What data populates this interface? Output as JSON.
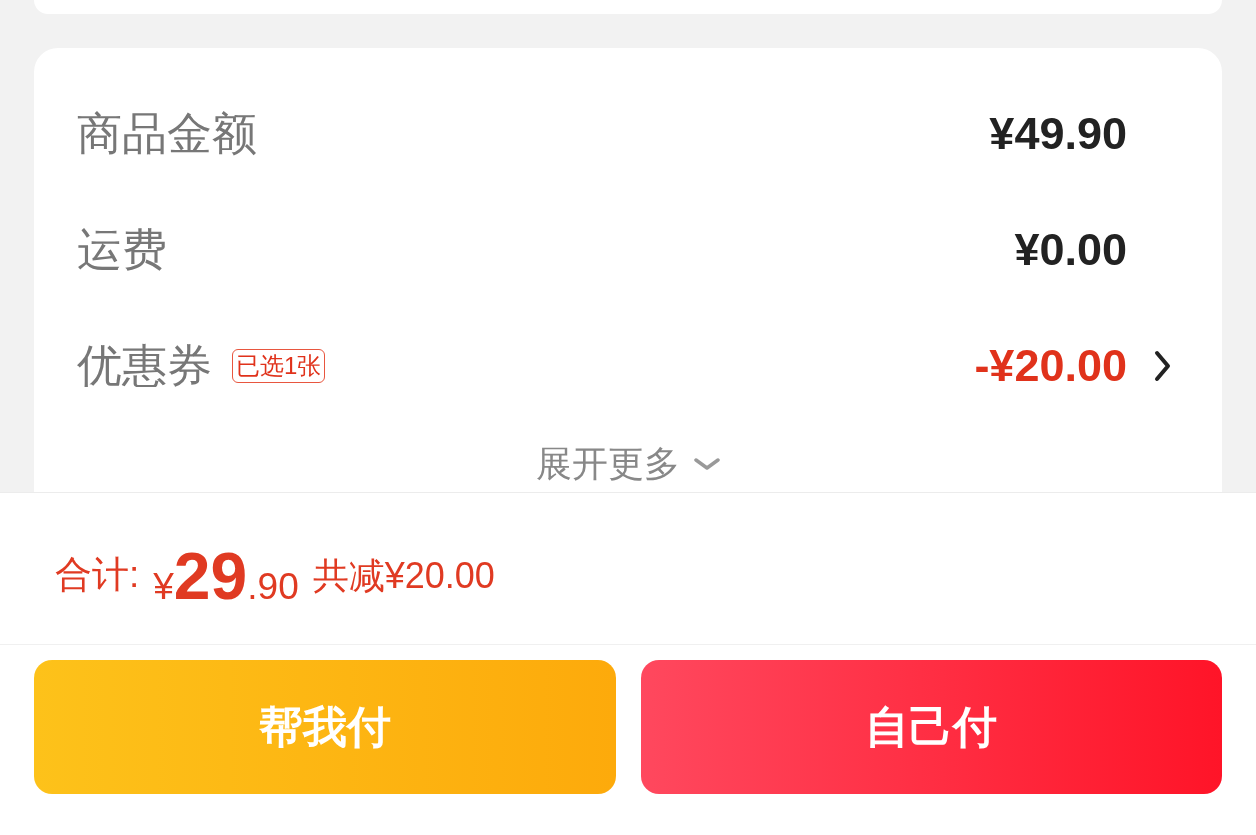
{
  "summary": {
    "rows": [
      {
        "kind": "amount",
        "label": "商品金额",
        "value": "¥49.90"
      },
      {
        "kind": "amount",
        "label": "运费",
        "value": "¥0.00"
      },
      {
        "kind": "discount",
        "label": "优惠券",
        "tag": "已选1张",
        "value": "-¥20.00"
      }
    ],
    "expand": "展开更多"
  },
  "footer": {
    "total_label": "合计:",
    "currency": "¥",
    "total_integer": "29",
    "total_decimal": ".90",
    "saved": "共减¥20.00"
  },
  "buttons": [
    {
      "kind": "secondary",
      "label": "帮我付"
    },
    {
      "kind": "primary",
      "label": "自己付"
    }
  ]
}
